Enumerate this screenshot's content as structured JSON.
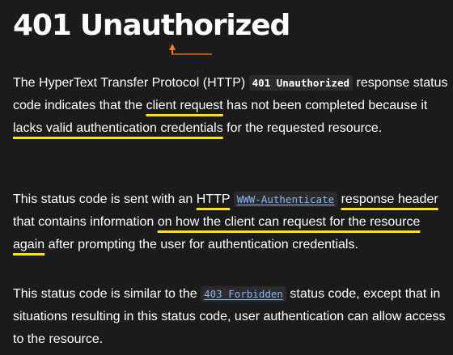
{
  "title": "401 Unauthorized",
  "paragraphs": {
    "p1": {
      "t1": "The HyperText Transfer Protocol (HTTP) ",
      "code": "401 Unauthorized",
      "t2": " response status code indicates that the ",
      "hl1": "client request",
      "t3": " has not been completed because it ",
      "hl2": "lacks valid authentication credentials",
      "t4": " for the requested resource."
    },
    "p2": {
      "t1": "This status code is sent with an ",
      "hl1": "HTTP",
      "t2": " ",
      "code_link": "WWW-Authenticate",
      "t3": " ",
      "hl2": "response header",
      "t4": " that contains information ",
      "hl3": "on how the client can request for the resource again",
      "t5": " after prompting the user for authentication credentials."
    },
    "p3": {
      "t1": "This status code is similar to the ",
      "code_link": "403 Forbidden",
      "t2": " status code, except that in situations resulting in this status code, user authentication can allow access to the resource."
    }
  },
  "colors": {
    "background": "#1b1b1b",
    "highlight_underline": "#ffe600",
    "link": "#8ab4f8",
    "cursor_marker": "#ff7a1a"
  }
}
